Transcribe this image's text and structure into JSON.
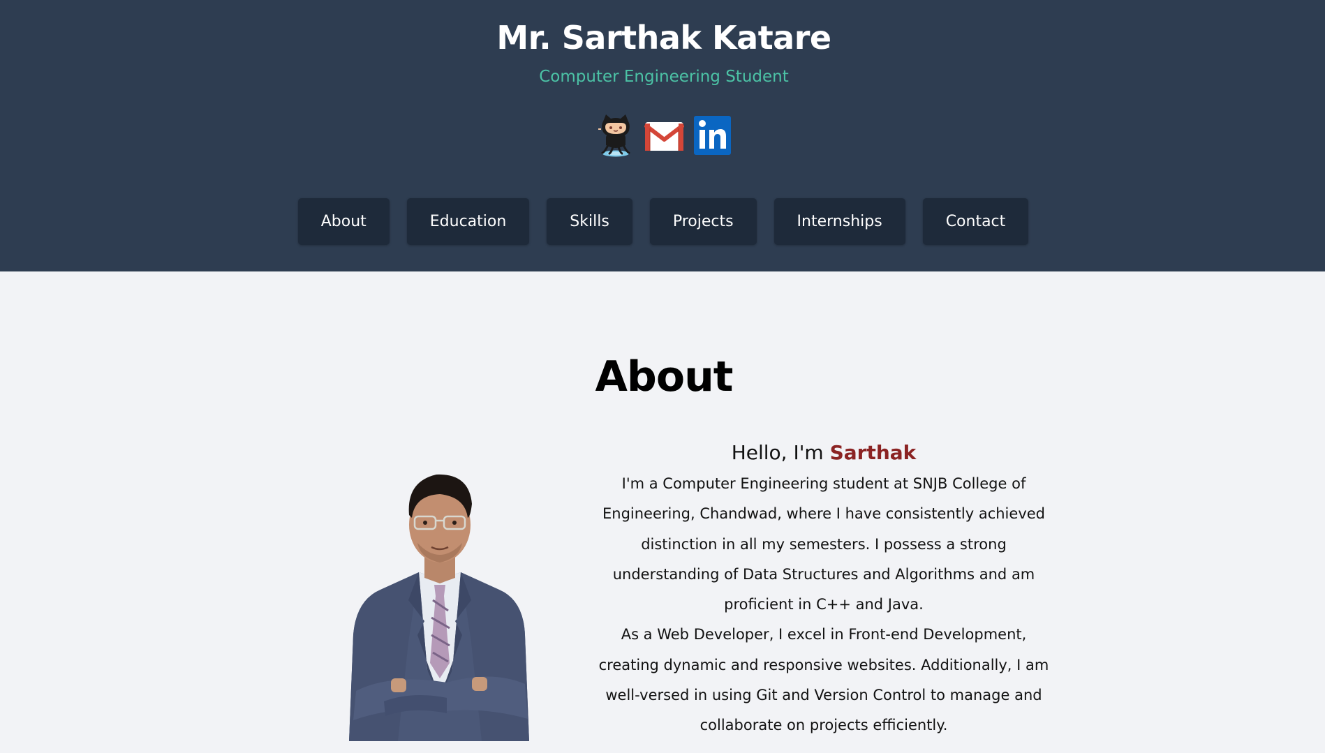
{
  "header": {
    "title": "Mr. Sarthak Katare",
    "subtitle": "Computer Engineering Student",
    "social_links": [
      {
        "icon": "github-octocat-icon"
      },
      {
        "icon": "gmail-icon"
      },
      {
        "icon": "linkedin-icon"
      }
    ]
  },
  "nav": {
    "items": [
      "About",
      "Education",
      "Skills",
      "Projects",
      "Internships",
      "Contact"
    ]
  },
  "about": {
    "heading": "About",
    "greeting_prefix": "Hello, I'm ",
    "greeting_name": "Sarthak",
    "paragraph1": "I'm a Computer Engineering student at SNJB College of Engineering, Chandwad, where I have consistently achieved distinction in all my semesters. I possess a strong understanding of Data Structures and Algorithms and am proficient in C++ and Java.",
    "paragraph2": "As a Web Developer, I excel in Front-end Development, creating dynamic and responsive websites. Additionally, I am well-versed in using Git and Version Control to manage and collaborate on projects efficiently."
  },
  "colors": {
    "header_bg": "#2e3d51",
    "nav_button_bg": "#1e2a3a",
    "subtitle": "#4cc3a6",
    "name_accent": "#8b2323",
    "page_bg": "#f2f3f6"
  }
}
